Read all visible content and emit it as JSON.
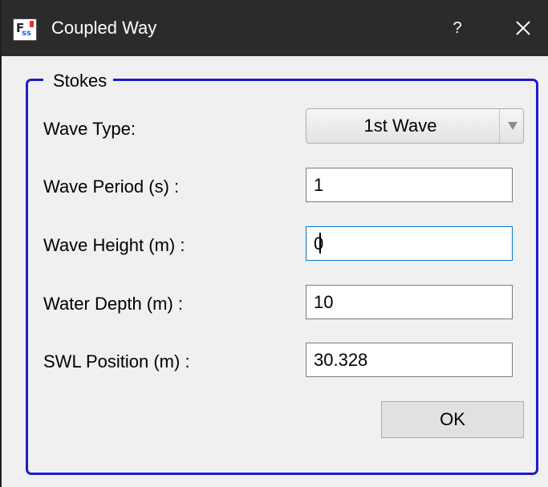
{
  "window": {
    "title": "Coupled Way",
    "help_label": "?",
    "icon_name": "fss-app-icon",
    "icon_letters": "FSS"
  },
  "group": {
    "title": "Stokes",
    "border_color": "#1c1ccc"
  },
  "wave_type": {
    "label": "Wave Type:",
    "selected": "1st Wave"
  },
  "wave_period": {
    "label": "Wave Period (s) :",
    "value": "1"
  },
  "wave_height": {
    "label": "Wave Height (m) :",
    "value": "0"
  },
  "water_depth": {
    "label": "Water Depth (m) :",
    "value": "10"
  },
  "swl_position": {
    "label": "SWL Position (m) :",
    "value": "30.328"
  },
  "ok_button": {
    "label": "OK"
  }
}
